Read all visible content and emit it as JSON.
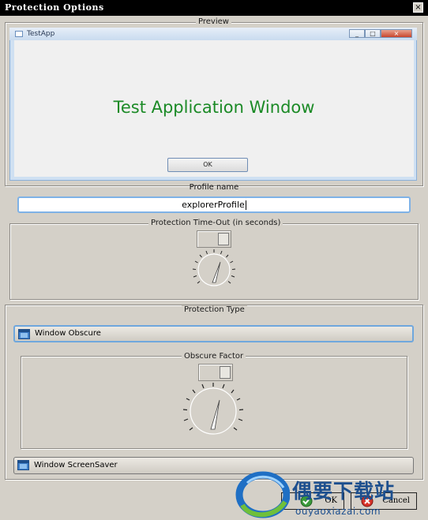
{
  "window": {
    "title": "Protection Options",
    "close_glyph": "×"
  },
  "preview": {
    "legend": "Preview",
    "app_title": "TestApp",
    "window_buttons": [
      "_",
      "□",
      "×"
    ],
    "heading": "Test Application Window",
    "ok_label": "OK",
    "heading_color": "#1b8a26"
  },
  "profile": {
    "label": "Profile name",
    "value": "explorerProfile"
  },
  "timeout": {
    "legend": "Protection Time-Out (in seconds)",
    "spinner_value": "",
    "dial_icon": "knob-dial-icon"
  },
  "protection_type": {
    "legend": "Protection Type",
    "obscure_label": "Window Obscure",
    "obscure_factor_legend": "Obscure Factor",
    "screensaver_label": "Window ScreenSaver"
  },
  "buttons": {
    "ok": "OK",
    "cancel": "Cancel"
  },
  "watermark": {
    "big": "偶要下载站",
    "small": "ouyaoxiazai.com"
  },
  "colors": {
    "accent": "#6fa7dd",
    "watermark": "#1d4f8e"
  }
}
